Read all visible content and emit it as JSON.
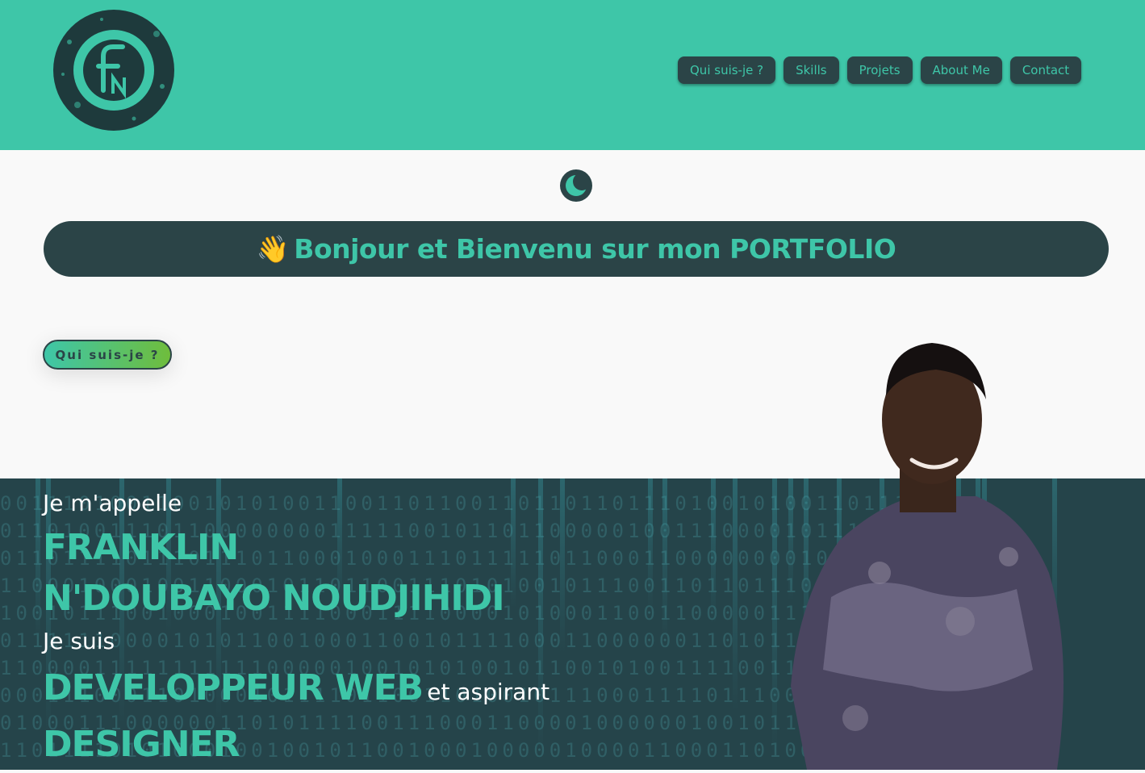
{
  "brand": {
    "logo_icon": "fn-monogram-logo"
  },
  "nav": {
    "items": [
      {
        "label": "Qui suis-je ?"
      },
      {
        "label": "Skills"
      },
      {
        "label": "Projets"
      },
      {
        "label": "About Me"
      },
      {
        "label": "Contact"
      }
    ]
  },
  "theme_toggle": {
    "icon": "moon-icon"
  },
  "welcome": {
    "emoji": "👋",
    "text": "Bonjour et Bienvenu sur mon PORTFOLIO"
  },
  "about_button": {
    "label": "Qui suis-je ?"
  },
  "hero": {
    "intro": "Je m'appelle",
    "first_name": "FRANKLIN",
    "last_name": "N'DOUBAYO NOUDJIHIDI",
    "role_intro": "Je suis",
    "role": "DEVELOPPEUR WEB",
    "role_connector": "et aspirant",
    "role2": "DESIGNER"
  },
  "colors": {
    "accent": "#3ec6a8",
    "dark": "#2b4447",
    "hero_bg": "#25444a",
    "page_bg": "#f9f9f9"
  }
}
